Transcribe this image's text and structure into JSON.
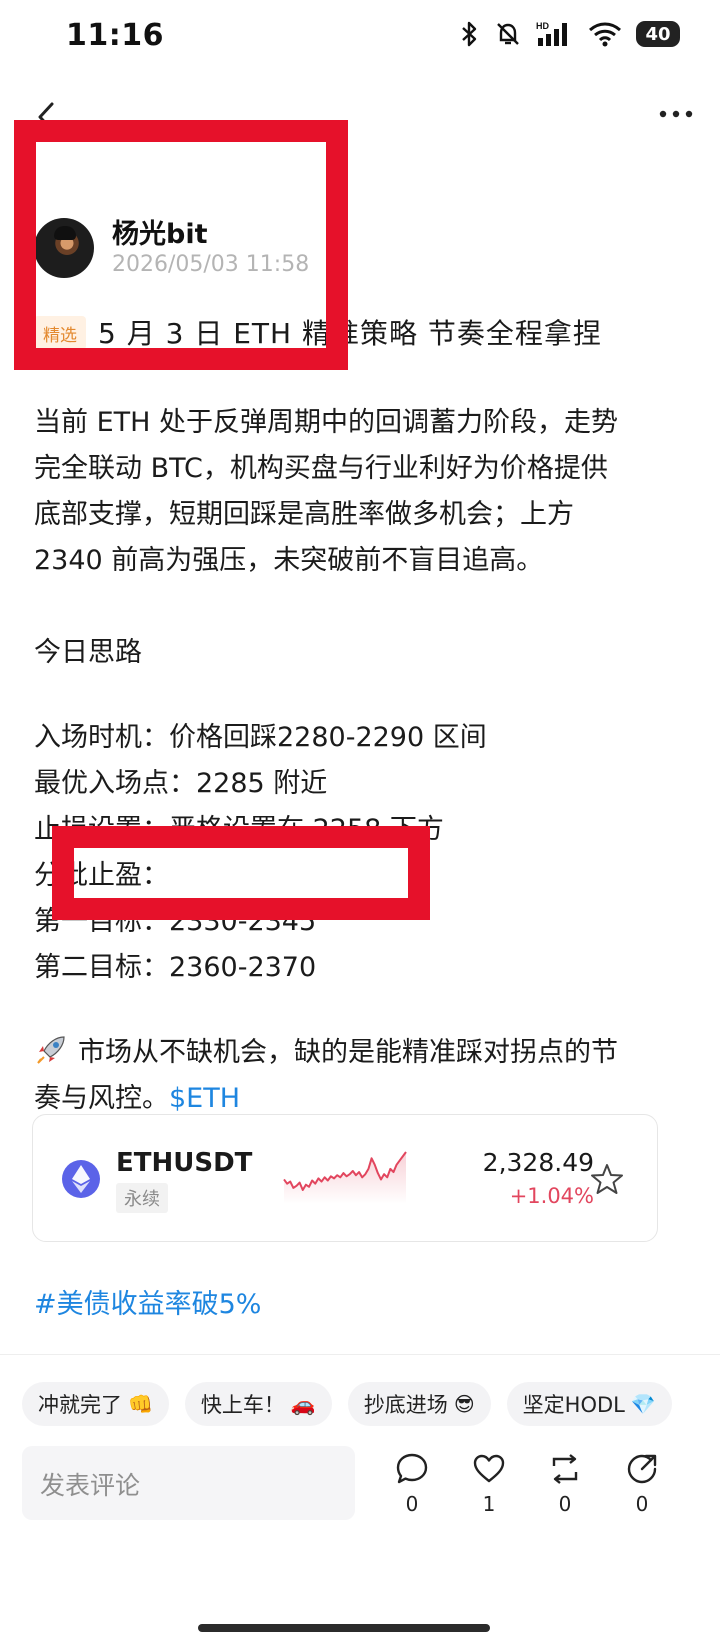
{
  "status_bar": {
    "time": "11:16",
    "battery": "40"
  },
  "post": {
    "author": "杨光bit",
    "timestamp": "2026/05/03 11:58",
    "featured_badge": "精选",
    "title": "5 月 3 日 ETH 精准策略 节奏全程拿捏",
    "paragraph1": [
      "当前 ETH 处于反弹周期中的回调蓄力阶段，走势",
      "完全联动 BTC，机构买盘与行业利好为价格提供",
      "底部支撑，短期回踩是高胜率做多机会；上方",
      "2340 前高为强压，未突破前不盲目追高。"
    ],
    "paragraph2": "今日思路",
    "plan": [
      "入场时机：价格回踩2280-2290 区间",
      "最优入场点：2285 附近",
      "止损设置：严格设置在 2258 下方",
      "分批止盈：",
      "第一目标：2330-2345",
      "第二目标：2360-2370"
    ],
    "closing_line1": "市场从不缺机会，缺的是能精准踩对拐点的节",
    "closing_line2": "奏与风控。",
    "cashtag": "$ETH",
    "hashtag": "#美债收益率破5%"
  },
  "ticker": {
    "symbol": "ETHUSDT",
    "contract_type": "永续",
    "price": "2,328.49",
    "change": "+1.04%",
    "change_color": "#e2465e",
    "sparkline": [
      32,
      36,
      34,
      40,
      38,
      35,
      42,
      37,
      39,
      33,
      36,
      31,
      34,
      30,
      33,
      29,
      31,
      28,
      30,
      26,
      29,
      27,
      24,
      28,
      25,
      30,
      27,
      22,
      12,
      18,
      26,
      32,
      27,
      30,
      22,
      25,
      18,
      14,
      10,
      6
    ]
  },
  "quick_replies": [
    {
      "label": "冲就完了",
      "emoji": "👊"
    },
    {
      "label": "快上车！",
      "emoji": "🚗"
    },
    {
      "label": "抄底进场",
      "emoji": "😎"
    },
    {
      "label": "坚定HODL",
      "emoji": "💎"
    }
  ],
  "comment": {
    "placeholder": "发表评论"
  },
  "actions": {
    "comments": "0",
    "likes": "1",
    "reposts": "0",
    "shares": "0"
  },
  "colors": {
    "link": "#1e86e0",
    "annotation": "#e6112a",
    "featured_bg": "#fff1e3",
    "featured_fg": "#e3892f"
  }
}
